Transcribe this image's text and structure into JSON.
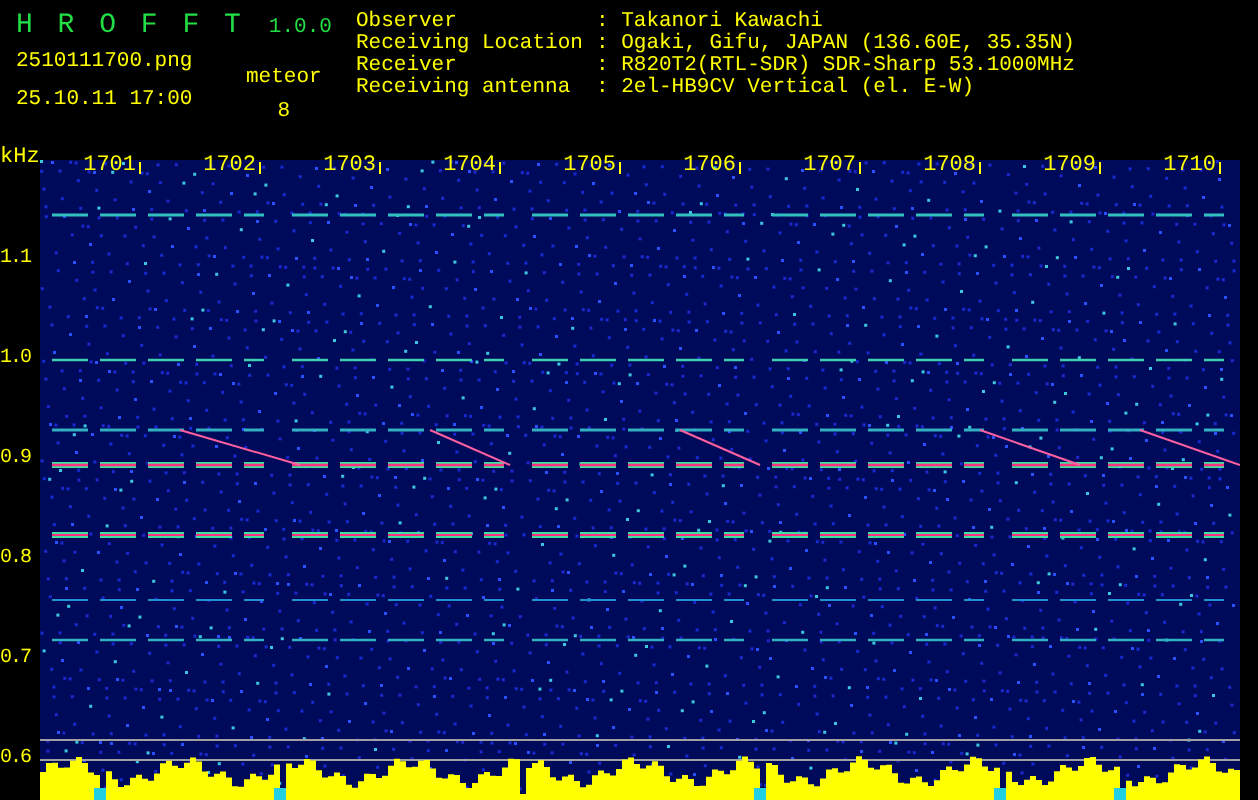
{
  "header": {
    "title": "H R O F F T",
    "version": "1.0.0",
    "filename": "2510111700.png",
    "datetime": "25.10.11 17:00",
    "meteor_label": "meteor",
    "meteor_count": "8"
  },
  "info": [
    {
      "label": "Observer",
      "value": ": Takanori Kawachi"
    },
    {
      "label": "Receiving Location",
      "value": ": Ogaki, Gifu, JAPAN (136.60E, 35.35N)"
    },
    {
      "label": "Receiver",
      "value": ": R820T2(RTL-SDR) SDR-Sharp 53.1000MHz"
    },
    {
      "label": "Receiving antenna",
      "value": ": 2el-HB9CV Vertical (el. E-W)"
    }
  ],
  "y_unit": "kHz",
  "y_labels": [
    "1.1",
    "1.0",
    "0.9",
    "0.8",
    "0.7",
    "0.6"
  ],
  "time_labels": [
    "1701",
    "1702",
    "1703",
    "1704",
    "1705",
    "1706",
    "1707",
    "1708",
    "1709",
    "1710"
  ]
}
